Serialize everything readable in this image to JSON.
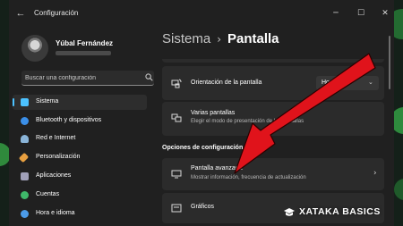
{
  "window": {
    "app_title": "Configuración",
    "back_icon": "back-arrow-icon",
    "controls": [
      "minimize-icon",
      "maximize-icon",
      "close-icon"
    ]
  },
  "user": {
    "name": "Yúbal Fernández"
  },
  "search": {
    "placeholder": "Buscar una configuración",
    "icon": "search-icon"
  },
  "sidebar": {
    "items": [
      {
        "label": "Sistema",
        "icon": "monitor-icon",
        "color": "#4cc2ff",
        "active": true
      },
      {
        "label": "Bluetooth y dispositivos",
        "icon": "bluetooth-icon",
        "color": "#3b8fe8",
        "active": false
      },
      {
        "label": "Red e Internet",
        "icon": "wifi-icon",
        "color": "#8ab4d8",
        "active": false
      },
      {
        "label": "Personalización",
        "icon": "brush-icon",
        "color": "#e8a040",
        "active": false
      },
      {
        "label": "Aplicaciones",
        "icon": "apps-icon",
        "color": "#a0a0b8",
        "active": false
      },
      {
        "label": "Cuentas",
        "icon": "person-icon",
        "color": "#3fb86a",
        "active": false
      },
      {
        "label": "Hora e idioma",
        "icon": "globe-clock-icon",
        "color": "#4c9be8",
        "active": false
      }
    ]
  },
  "breadcrumb": {
    "parent": "Sistema",
    "current": "Pantalla"
  },
  "settings": {
    "orientation": {
      "title": "Orientación de la pantalla",
      "value": "Horizontal",
      "icon": "orientation-icon"
    },
    "multiple_displays": {
      "title": "Varias pantallas",
      "subtitle": "Elegir el modo de presentación de las pantallas",
      "icon": "multiple-displays-icon"
    },
    "section_heading": "Opciones de configuración re",
    "advanced_display": {
      "title": "Pantalla avanzada",
      "subtitle": "Mostrar información, frecuencia de actualización",
      "icon": "monitor-icon"
    },
    "graphics": {
      "title": "Gráficos",
      "icon": "graphics-icon"
    }
  },
  "overlay": {
    "arrow_color": "#e0131b",
    "watermark": "XATAKA BASICS",
    "watermark_icon": "graduation-cap-icon"
  },
  "colors": {
    "accent": "#4cc2ff",
    "window_bg": "#202020",
    "card_bg": "#2b2b2b"
  }
}
